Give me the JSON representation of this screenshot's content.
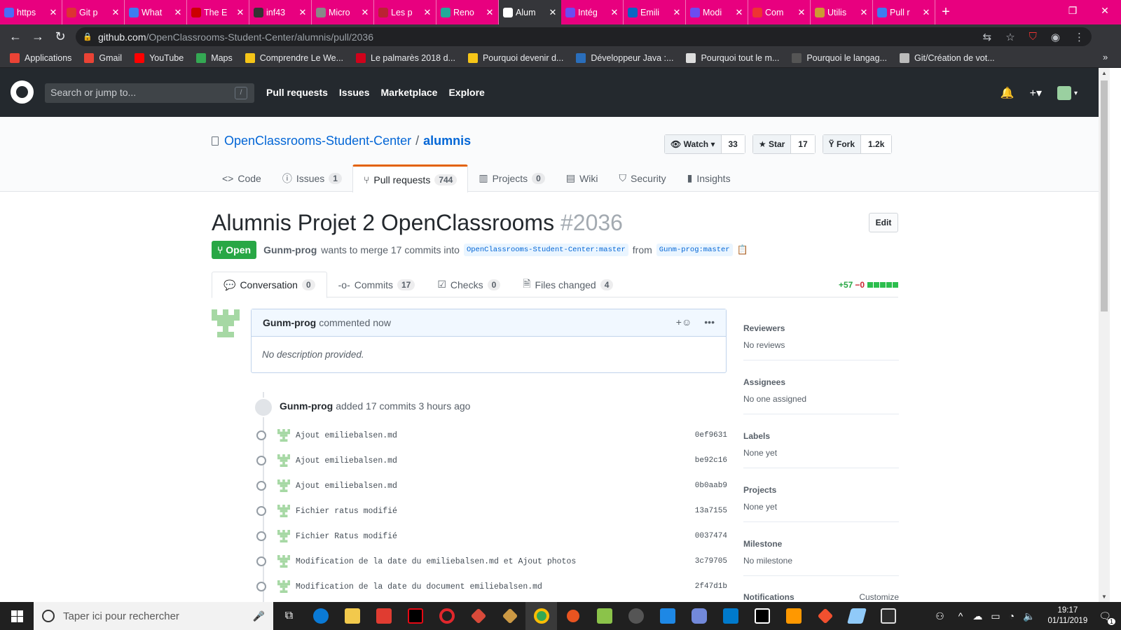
{
  "browser": {
    "tabs": [
      {
        "title": "https",
        "color": "#4a6cf7"
      },
      {
        "title": "Git p",
        "color": "#d33"
      },
      {
        "title": "What",
        "color": "#3d7cf0"
      },
      {
        "title": "The E",
        "color": "#c00"
      },
      {
        "title": "inf43",
        "color": "#333"
      },
      {
        "title": "Micro",
        "color": "#888"
      },
      {
        "title": "Les p",
        "color": "#b23"
      },
      {
        "title": "Reno",
        "color": "#2a9"
      },
      {
        "title": "Alum",
        "color": "#fff",
        "active": true
      },
      {
        "title": "Intég",
        "color": "#6c4cf2"
      },
      {
        "title": "Emili",
        "color": "#0a66c2"
      },
      {
        "title": "Modi",
        "color": "#6c4cf2"
      },
      {
        "title": "Com",
        "color": "#e33"
      },
      {
        "title": "Utilis",
        "color": "#c93"
      },
      {
        "title": "Pull r",
        "color": "#3d7cf0"
      }
    ],
    "url_host": "github.com",
    "url_path": "/OpenClassrooms-Student-Center/alumnis/pull/2036",
    "bookmarks": [
      {
        "label": "Applications",
        "color": "#ea4335"
      },
      {
        "label": "Gmail",
        "color": "#ea4335"
      },
      {
        "label": "YouTube",
        "color": "#ff0000"
      },
      {
        "label": "Maps",
        "color": "#34a853"
      },
      {
        "label": "Comprendre Le We...",
        "color": "#f5c518"
      },
      {
        "label": "Le palmarès 2018 d...",
        "color": "#d0021b"
      },
      {
        "label": "Pourquoi devenir d...",
        "color": "#f5c518"
      },
      {
        "label": "Développeur Java :...",
        "color": "#2a6ebb"
      },
      {
        "label": "Pourquoi tout le m...",
        "color": "#ddd"
      },
      {
        "label": "Pourquoi le langag...",
        "color": "#555"
      },
      {
        "label": "Git/Création de vot...",
        "color": "#bbb"
      }
    ]
  },
  "github": {
    "search_placeholder": "Search or jump to...",
    "slash": "/",
    "nav": [
      "Pull requests",
      "Issues",
      "Marketplace",
      "Explore"
    ]
  },
  "repo": {
    "owner": "OpenClassrooms-Student-Center",
    "separator": "/",
    "name": "alumnis",
    "watch_label": "Watch",
    "watch_count": "33",
    "star_label": "Star",
    "star_count": "17",
    "fork_label": "Fork",
    "fork_count": "1.2k",
    "tabs": [
      {
        "label": "Code",
        "count": ""
      },
      {
        "label": "Issues",
        "count": "1"
      },
      {
        "label": "Pull requests",
        "count": "744"
      },
      {
        "label": "Projects",
        "count": "0"
      },
      {
        "label": "Wiki",
        "count": ""
      },
      {
        "label": "Security",
        "count": ""
      },
      {
        "label": "Insights",
        "count": ""
      }
    ]
  },
  "pr": {
    "title": "Alumnis Projet 2 OpenClassrooms",
    "number": "#2036",
    "edit_label": "Edit",
    "state": "Open",
    "author": "Gunm-prog",
    "merge_text": "wants to merge 17 commits into",
    "base_branch": "OpenClassrooms-Student-Center:master",
    "from_text": "from",
    "head_branch": "Gunm-prog:master",
    "tabs": [
      {
        "label": "Conversation",
        "count": "0"
      },
      {
        "label": "Commits",
        "count": "17"
      },
      {
        "label": "Checks",
        "count": "0"
      },
      {
        "label": "Files changed",
        "count": "4"
      }
    ],
    "additions": "+57",
    "deletions": "−0"
  },
  "comment": {
    "author": "Gunm-prog",
    "time": "commented now",
    "body": "No description provided."
  },
  "push": {
    "author": "Gunm-prog",
    "text": "added 17 commits 3 hours ago"
  },
  "commits": [
    {
      "message": "Ajout emiliebalsen.md",
      "sha": "0ef9631"
    },
    {
      "message": "Ajout emiliebalsen.md",
      "sha": "be92c16"
    },
    {
      "message": "Ajout emiliebalsen.md",
      "sha": "0b0aab9"
    },
    {
      "message": "Fichier ratus modifié",
      "sha": "13a7155"
    },
    {
      "message": "Fichier Ratus modifié",
      "sha": "0037474"
    },
    {
      "message": "Modification de la date du emiliebalsen.md et Ajout photos",
      "sha": "3c79705"
    },
    {
      "message": "Modification de la date du document emiliebalsen.md",
      "sha": "2f47d1b"
    }
  ],
  "sidebar": {
    "reviewers_h": "Reviewers",
    "reviewers_v": "No reviews",
    "assignees_h": "Assignees",
    "assignees_v": "No one assigned",
    "labels_h": "Labels",
    "labels_v": "None yet",
    "projects_h": "Projects",
    "projects_v": "None yet",
    "milestone_h": "Milestone",
    "milestone_v": "No milestone",
    "notifications_h": "Notifications",
    "customize": "Customize"
  },
  "taskbar": {
    "search_placeholder": "Taper ici pour rechercher",
    "time": "19:17",
    "date": "01/11/2019",
    "notif_count": "1"
  }
}
